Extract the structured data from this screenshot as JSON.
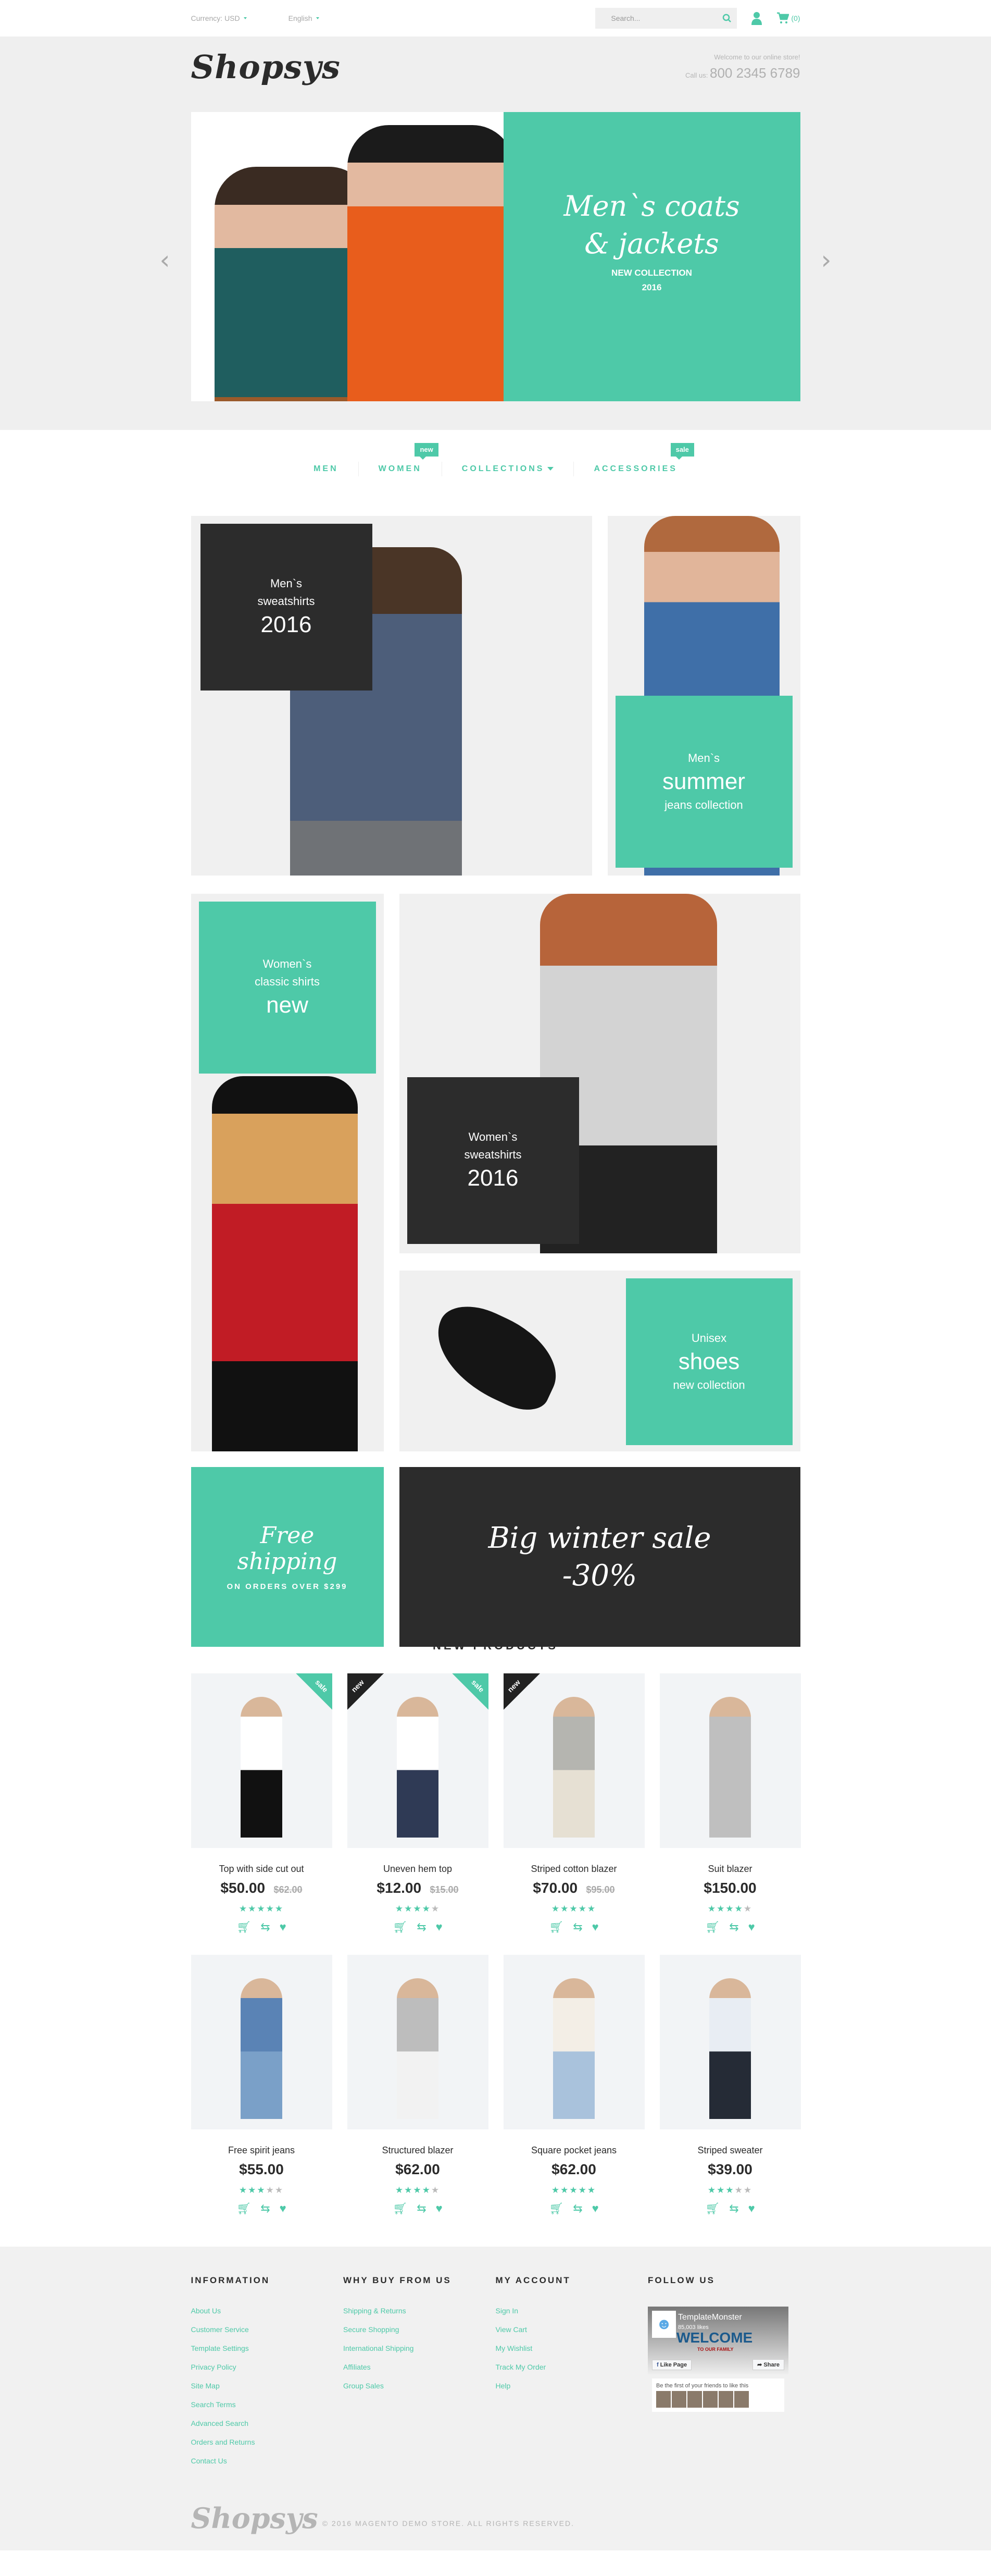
{
  "topbar": {
    "currency": "Currency: USD",
    "language": "English",
    "search_placeholder": "Search...",
    "cart_count": "(0)"
  },
  "header": {
    "logo": "Shopsys",
    "welcome": "Welcome to our online store!",
    "call_label": "Call us:",
    "phone": "800 2345 6789"
  },
  "slider": {
    "title_line1": "Men`s coats",
    "title_line2": "& jackets",
    "subtitle": "NEW COLLECTION",
    "year": "2016",
    "prev_icon": "chevron-left-icon",
    "next_icon": "chevron-right-icon"
  },
  "nav": {
    "items": [
      {
        "label": "MEN",
        "badge": null
      },
      {
        "label": "WOMEN",
        "badge": "new"
      },
      {
        "label": "COLLECTIONS",
        "badge": null,
        "dropdown": true
      },
      {
        "label": "ACCESSORIES",
        "badge": "sale"
      }
    ]
  },
  "banners": {
    "mens_sweatshirts": {
      "line1": "Men`s",
      "line2": "sweatshirts",
      "big": "2016"
    },
    "mens_summer": {
      "line1": "Men`s",
      "big": "summer",
      "line3": "jeans collection"
    },
    "womens_shirts": {
      "line1": "Women`s",
      "line2": "classic shirts",
      "big": "new"
    },
    "womens_sweatshirts": {
      "line1": "Women`s",
      "line2": "sweatshirts",
      "big": "2016"
    },
    "unisex_shoes": {
      "line1": "Unisex",
      "big": "shoes",
      "line3": "new collection"
    },
    "free_shipping": {
      "line1": "Free",
      "line2": "shipping",
      "sub": "ON ORDERS OVER $299"
    },
    "winter_sale": {
      "line1": "Big winter sale",
      "line2": "-30%"
    }
  },
  "new_products": {
    "title": "NEW PRODUCTS",
    "items": [
      {
        "name": "Top with side cut out",
        "price": "$50.00",
        "old_price": "$62.00",
        "rating": 5,
        "badges": [
          "sale"
        ]
      },
      {
        "name": "Uneven hem top",
        "price": "$12.00",
        "old_price": "$15.00",
        "rating": 4,
        "badges": [
          "new",
          "sale"
        ]
      },
      {
        "name": "Striped cotton blazer",
        "price": "$70.00",
        "old_price": "$95.00",
        "rating": 5,
        "badges": [
          "new"
        ]
      },
      {
        "name": "Suit blazer",
        "price": "$150.00",
        "old_price": null,
        "rating": 4,
        "badges": []
      },
      {
        "name": "Free spirit jeans",
        "price": "$55.00",
        "old_price": null,
        "rating": 3,
        "badges": []
      },
      {
        "name": "Structured blazer",
        "price": "$62.00",
        "old_price": null,
        "rating": 4,
        "badges": []
      },
      {
        "name": "Square pocket jeans",
        "price": "$62.00",
        "old_price": null,
        "rating": 5,
        "badges": []
      },
      {
        "name": "Striped sweater",
        "price": "$39.00",
        "old_price": null,
        "rating": 3,
        "badges": []
      }
    ]
  },
  "footer": {
    "columns": [
      {
        "title": "INFORMATION",
        "links": [
          "About Us",
          "Customer Service",
          "Template Settings",
          "Privacy Policy",
          "Site Map",
          "Search Terms",
          "Advanced Search",
          "Orders and Returns",
          "Contact Us"
        ]
      },
      {
        "title": "WHY BUY FROM US",
        "links": [
          "Shipping & Returns",
          "Secure Shopping",
          "International Shipping",
          "Affiliates",
          "Group Sales"
        ]
      },
      {
        "title": "MY ACCOUNT",
        "links": [
          "Sign In",
          "View Cart",
          "My Wishlist",
          "Track My Order",
          "Help"
        ]
      }
    ],
    "follow": {
      "title": "FOLLOW US",
      "page_name": "TemplateMonster",
      "likes": "85,003 likes",
      "welcome": "WELCOME",
      "family": "TO OUR FAMILY",
      "like_button": "Like Page",
      "share_button": "Share",
      "friends_text": "Be the first of your friends to like this"
    },
    "logo": "Shopsys",
    "copyright": "© 2016 MAGENTO DEMO STORE. ALL RIGHTS RESERVED."
  },
  "colors": {
    "accent": "#4ec9a8",
    "dark": "#2c2c2c",
    "bg_gray": "#efefef"
  }
}
